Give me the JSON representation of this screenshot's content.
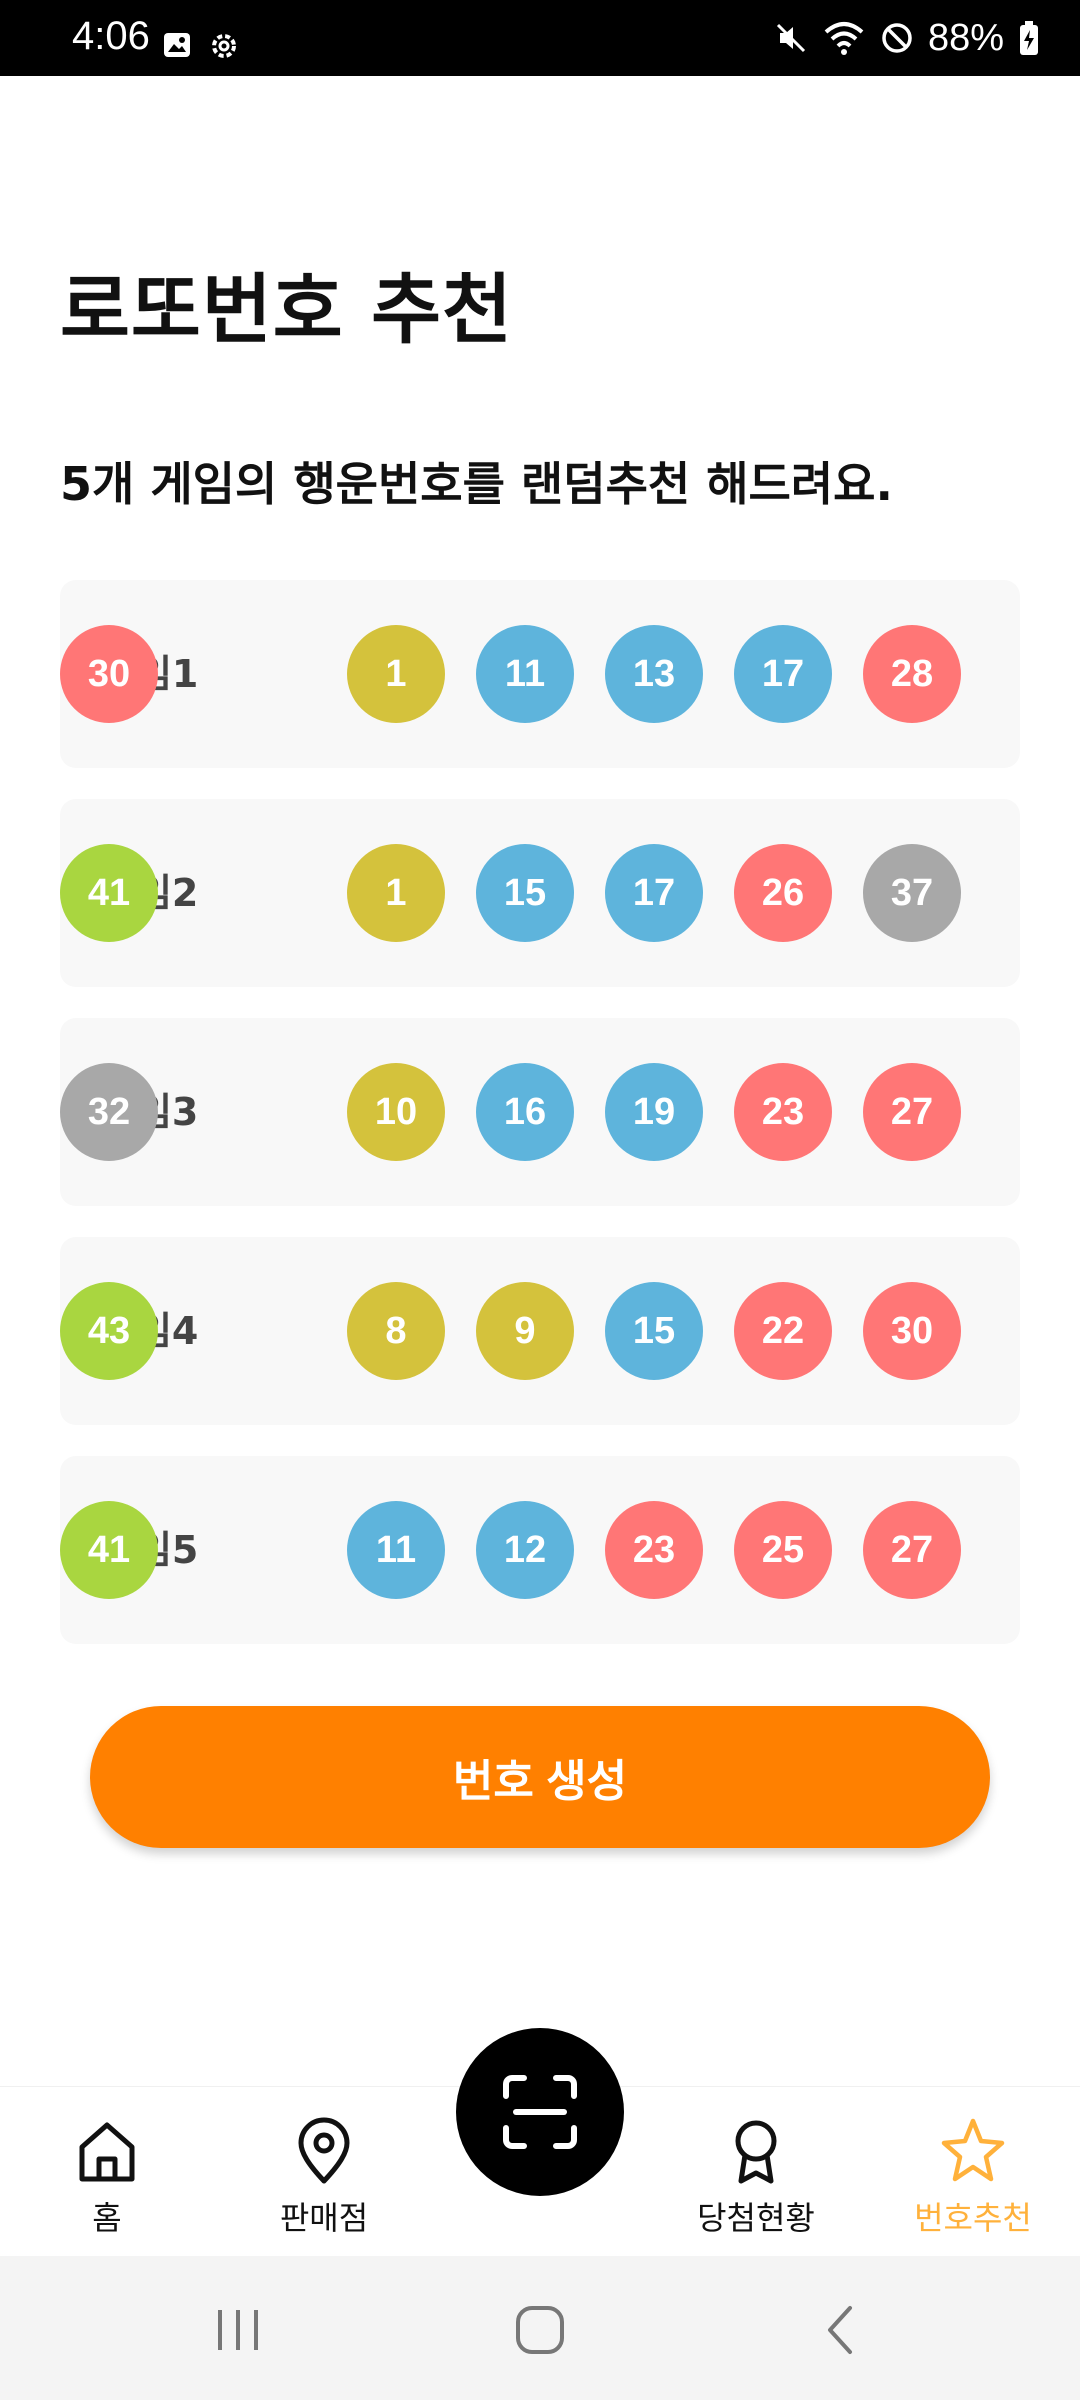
{
  "status_bar": {
    "time": "4:06",
    "battery": "88%",
    "left_icons": [
      "image-icon",
      "gear-icon"
    ],
    "right_icons": [
      "mute-icon",
      "wifi-icon",
      "block-icon",
      "battery-charging-icon"
    ]
  },
  "page": {
    "title": "로또번호 추천",
    "subtitle": "5개 게임의 행운번호를 랜덤추천 해드려요."
  },
  "ball_colors": {
    "yellow": "#d4c23c",
    "blue": "#5eb4dc",
    "red": "#ff7676",
    "gray": "#a8a8a8",
    "green": "#a9d640"
  },
  "games": [
    {
      "label": "게임1",
      "numbers": [
        "1",
        "11",
        "13",
        "17",
        "28",
        "30"
      ]
    },
    {
      "label": "게임2",
      "numbers": [
        "1",
        "15",
        "17",
        "26",
        "37",
        "41"
      ]
    },
    {
      "label": "게임3",
      "numbers": [
        "10",
        "16",
        "19",
        "23",
        "27",
        "32"
      ]
    },
    {
      "label": "게임4",
      "numbers": [
        "8",
        "9",
        "15",
        "22",
        "30",
        "43"
      ]
    },
    {
      "label": "게임5",
      "numbers": [
        "11",
        "12",
        "23",
        "25",
        "27",
        "41"
      ]
    }
  ],
  "actions": {
    "generate_label": "번호 생성"
  },
  "bottom_nav": {
    "items": [
      {
        "label": "홈",
        "icon": "home-icon"
      },
      {
        "label": "판매점",
        "icon": "location-pin-icon"
      },
      {
        "label": "당첨현황",
        "icon": "award-icon"
      },
      {
        "label": "번호추천",
        "icon": "star-icon",
        "active": true
      }
    ],
    "center_button_icon": "scan-icon",
    "active_color": "#ffb13b"
  },
  "system_nav": [
    "recent-apps-icon",
    "home-circle-icon",
    "back-icon"
  ]
}
